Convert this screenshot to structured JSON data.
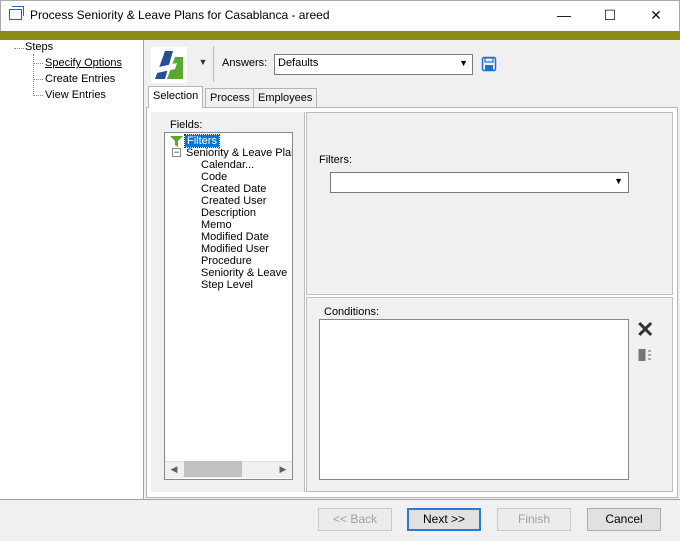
{
  "window": {
    "title": "Process Seniority & Leave Plans for Casablanca - areed",
    "minimize_glyph": "—",
    "maximize_glyph": "☐",
    "close_glyph": "✕"
  },
  "nav": {
    "root": "Steps",
    "items": [
      {
        "label": "Specify Options",
        "selected": true
      },
      {
        "label": "Create Entries",
        "selected": false
      },
      {
        "label": "View Entries",
        "selected": false
      }
    ]
  },
  "toolbar": {
    "answers_label": "Answers:",
    "answers_value": "Defaults",
    "logo_color_dark": "#2a4f8f",
    "logo_color_green": "#5aa832"
  },
  "tabs": [
    {
      "label": "Selection",
      "active": true
    },
    {
      "label": "Process",
      "active": false
    },
    {
      "label": "Employees",
      "active": false
    }
  ],
  "fields": {
    "label": "Fields:",
    "tree": {
      "filters": "Filters",
      "group": "Seniority & Leave Plan",
      "group_toggle": "−",
      "children": [
        "Calendar...",
        "Code",
        "Created Date",
        "Created User",
        "Description",
        "Memo",
        "Modified Date",
        "Modified User",
        "Procedure",
        "Seniority & Leave",
        "Step Level"
      ]
    }
  },
  "filters": {
    "label": "Filters:",
    "value": ""
  },
  "conditions": {
    "label": "Conditions:"
  },
  "buttons": {
    "back": "<< Back",
    "next": "Next >>",
    "finish": "Finish",
    "cancel": "Cancel"
  },
  "colors": {
    "accent_bar": "#8b8b16",
    "selection": "#0078d7"
  }
}
